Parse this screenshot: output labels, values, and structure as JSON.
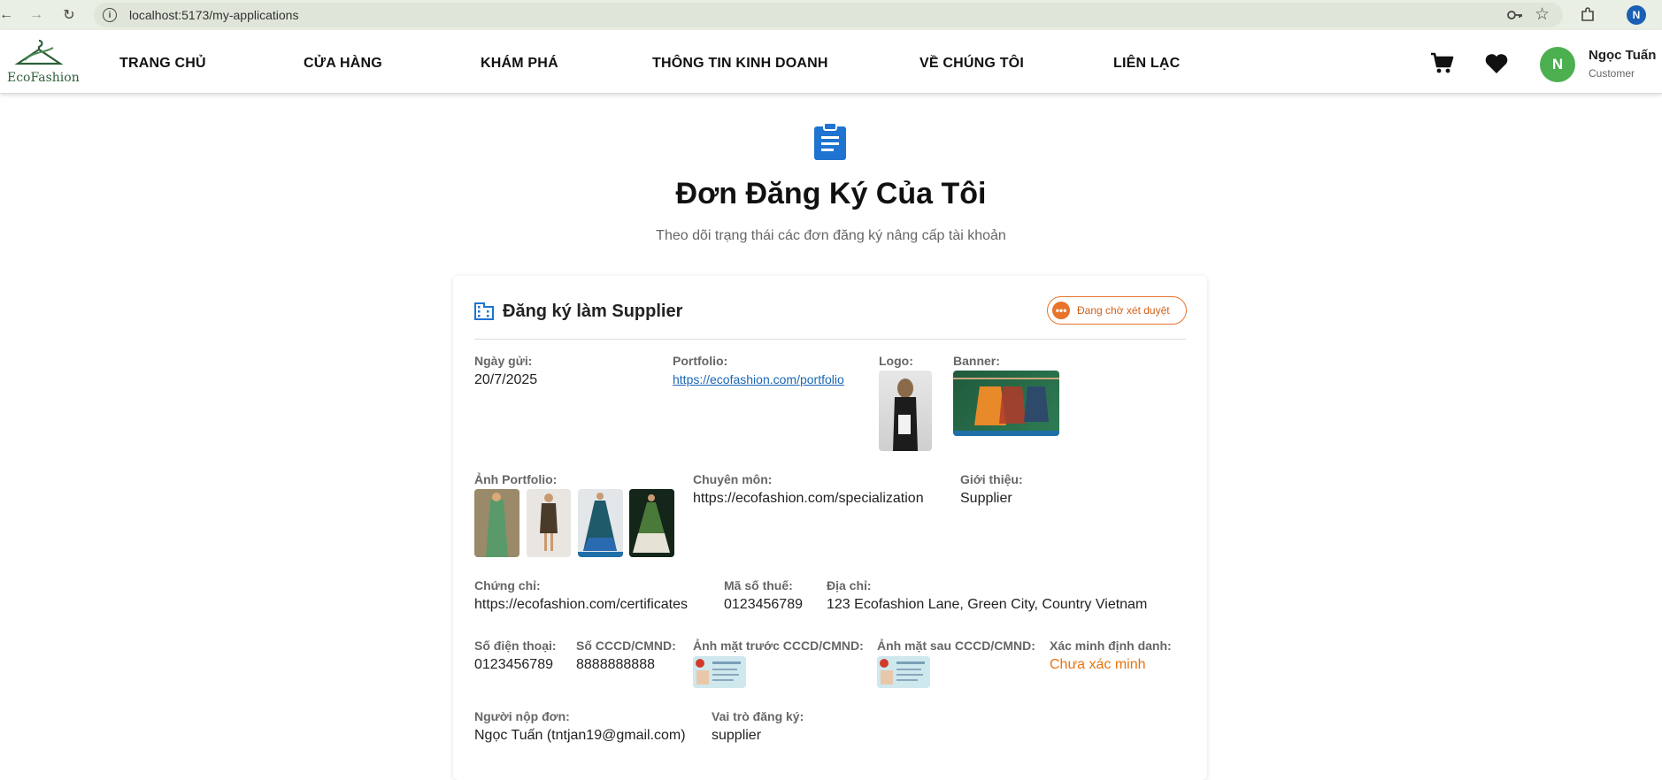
{
  "browser": {
    "url": "localhost:5173/my-applications",
    "profile_initial": "N"
  },
  "header": {
    "logo_text": "EcoFashion",
    "nav": [
      "TRANG CHỦ",
      "CỬA HÀNG",
      "KHÁM PHÁ",
      "THÔNG TIN KINH DOANH",
      "VỀ CHÚNG TÔI",
      "LIÊN LẠC"
    ],
    "user": {
      "initial": "N",
      "name": "Ngọc Tuấn",
      "role": "Customer"
    }
  },
  "page": {
    "title": "Đơn Đăng Ký Của Tôi",
    "subtitle": "Theo dõi trạng thái các đơn đăng ký nâng cấp tài khoản"
  },
  "application": {
    "title": "Đăng ký làm Supplier",
    "status": "Đang chờ xét duyệt",
    "status_color": "#e8732a",
    "submitted_label": "Ngày gửi:",
    "submitted_value": "20/7/2025",
    "portfolio_label": "Portfolio:",
    "portfolio_value": "https://ecofashion.com/portfolio",
    "logo_label": "Logo:",
    "banner_label": "Banner:",
    "portfolio_images_label": "Ảnh Portfolio:",
    "specialization_label": "Chuyên môn:",
    "specialization_value": "https://ecofashion.com/specialization",
    "intro_label": "Giới thiệu:",
    "intro_value": "Supplier",
    "certificates_label": "Chứng chỉ:",
    "certificates_value": "https://ecofashion.com/certificates",
    "tax_label": "Mã số thuế:",
    "tax_value": "0123456789",
    "address_label": "Địa chỉ:",
    "address_value": "123 Ecofashion Lane, Green City, Country Vietnam",
    "phone_label": "Số điện thoại:",
    "phone_value": "0123456789",
    "id_label": "Số CCCD/CMND:",
    "id_value": "8888888888",
    "id_front_label": "Ảnh mặt trước CCCD/CMND:",
    "id_back_label": "Ảnh mặt sau CCCD/CMND:",
    "verify_label": "Xác minh định danh:",
    "verify_value": "Chưa xác minh",
    "verify_color": "#e8730f",
    "applicant_label": "Người nộp đơn:",
    "applicant_value": "Ngọc Tuấn (tntjan19@gmail.com)",
    "role_label": "Vai trò đăng ký:",
    "role_value": "supplier"
  }
}
